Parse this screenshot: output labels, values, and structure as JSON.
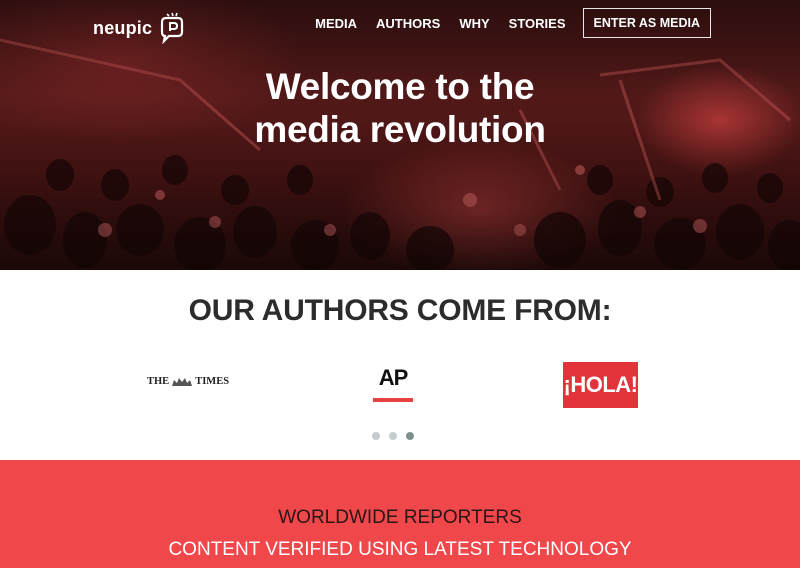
{
  "brand": {
    "name": "neupic"
  },
  "nav": {
    "links": [
      "MEDIA",
      "AUTHORS",
      "WHY",
      "STORIES"
    ],
    "cta": "ENTER AS MEDIA"
  },
  "hero": {
    "title_line1": "Welcome to the",
    "title_line2": "media revolution"
  },
  "authors": {
    "title": "OUR AUTHORS COME FROM:",
    "logos": {
      "times_left": "THE",
      "times_right": "TIMES",
      "ap": "AP",
      "hola": "¡HOLA!"
    },
    "carousel": {
      "count": 3,
      "active_index": 2
    }
  },
  "features": {
    "line1": "WORLDWIDE REPORTERS",
    "line2": "CONTENT VERIFIED USING LATEST TECHNOLOGY"
  },
  "colors": {
    "accent": "#f0474a",
    "hola_red": "#e2333a",
    "ap_bar": "#e8433f"
  },
  "icons": {
    "logo_mark": "chat-bubble-p-icon",
    "times_crest": "crest-icon"
  }
}
